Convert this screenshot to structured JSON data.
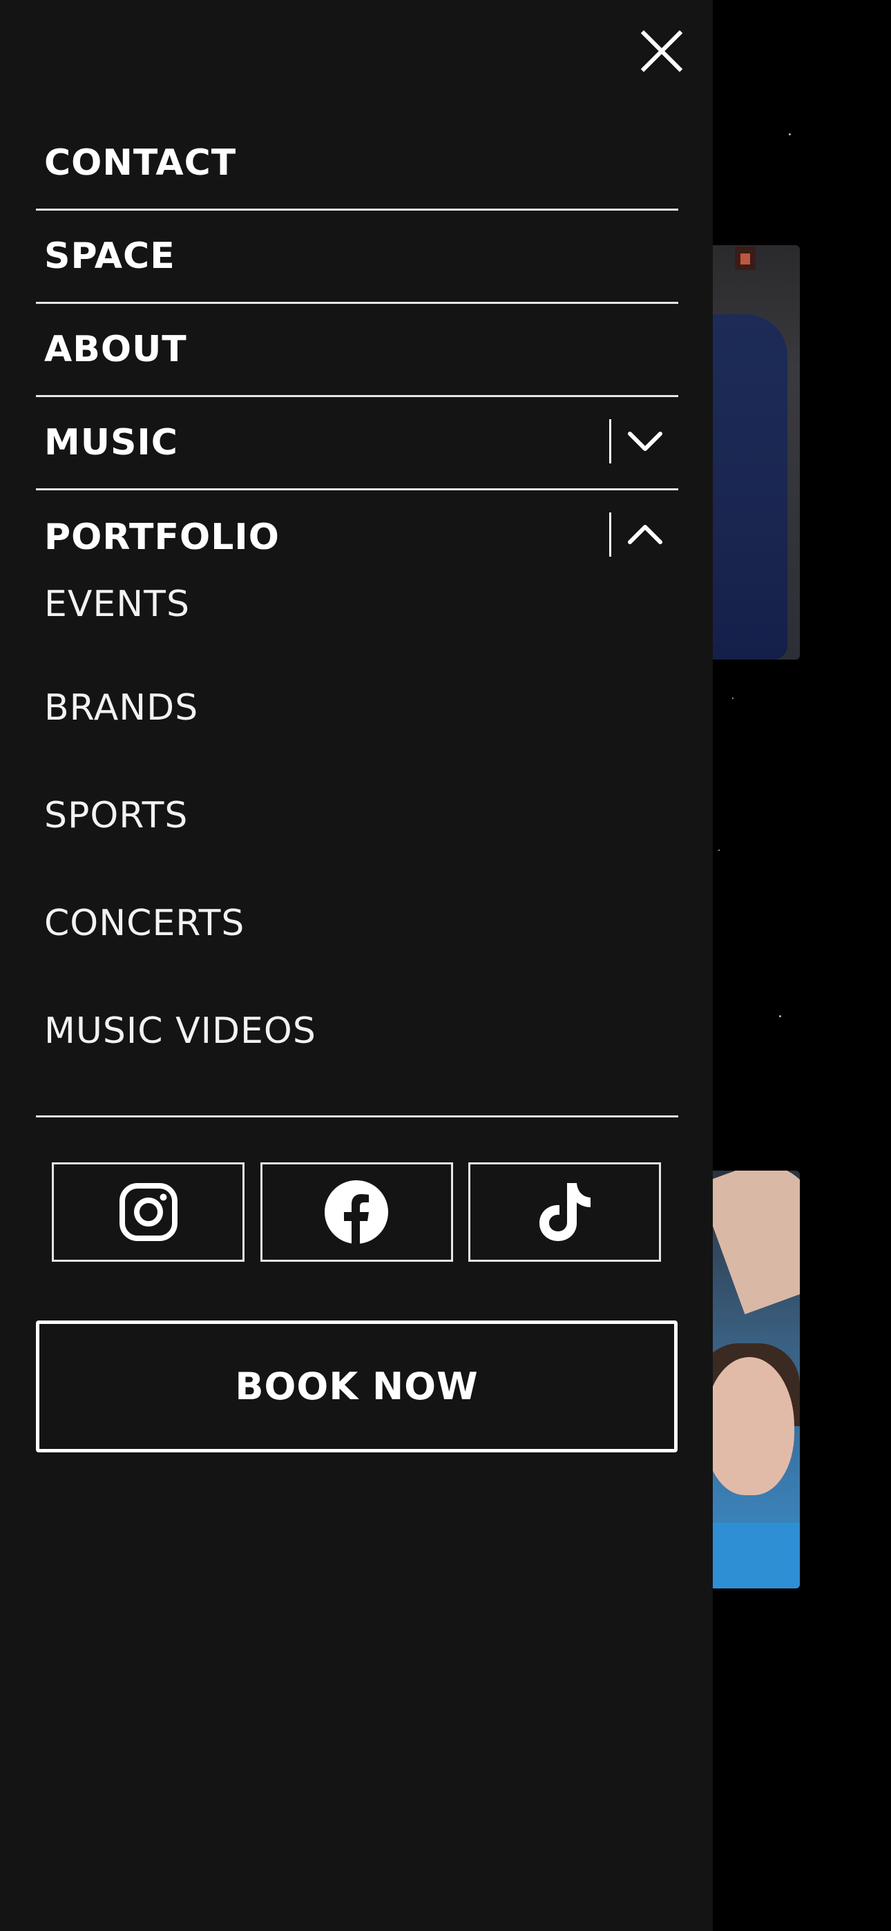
{
  "colors": {
    "drawer_background": "#141414",
    "page_background": "#000000",
    "text": "#ffffff",
    "divider": "#e6e6e6"
  },
  "drawer": {
    "close_icon": "close-icon",
    "nav": {
      "items": [
        {
          "label": "CONTACT"
        },
        {
          "label": "SPACE"
        },
        {
          "label": "ABOUT"
        },
        {
          "label": "MUSIC",
          "expanded": false,
          "icon": "chevron-down-icon"
        },
        {
          "label": "PORTFOLIO",
          "expanded": true,
          "icon": "chevron-up-icon"
        }
      ],
      "portfolio_submenu": [
        {
          "label": "EVENTS"
        },
        {
          "label": "BRANDS"
        },
        {
          "label": "SPORTS"
        },
        {
          "label": "CONCERTS"
        },
        {
          "label": "MUSIC VIDEOS"
        }
      ]
    },
    "socials": [
      {
        "icon": "instagram-icon"
      },
      {
        "icon": "facebook-icon"
      },
      {
        "icon": "tiktok-icon"
      }
    ],
    "book_now_label": "BOOK NOW"
  }
}
